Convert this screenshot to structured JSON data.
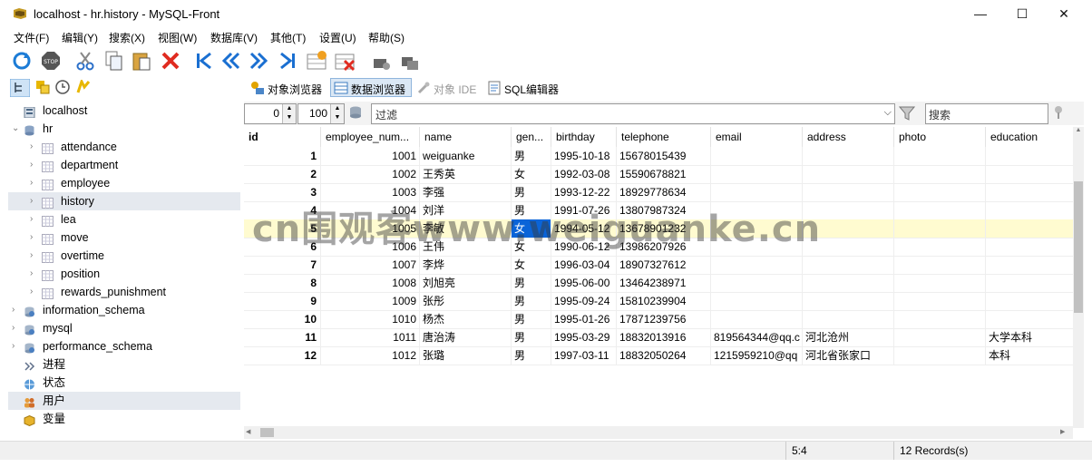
{
  "window": {
    "title": "localhost - hr.history - MySQL-Front",
    "minimize": "—",
    "maximize": "☐",
    "close": "✕"
  },
  "menu": [
    "文件(F)",
    "编辑(Y)",
    "搜索(X)",
    "视图(W)",
    "数据库(V)",
    "其他(T)",
    "设置(U)",
    "帮助(S)"
  ],
  "tabs": {
    "object_browser": "对象浏览器",
    "data_browser": "数据浏览器",
    "object_ide": "对象 IDE",
    "sql_editor": "SQL编辑器"
  },
  "tree": {
    "items": [
      {
        "label": "localhost",
        "level": 0,
        "icon": "server-icon",
        "chevron": ""
      },
      {
        "label": "hr",
        "level": 0,
        "icon": "database-icon",
        "chevron": "⌄"
      },
      {
        "label": "attendance",
        "level": 1,
        "icon": "table-icon",
        "chevron": "›"
      },
      {
        "label": "department",
        "level": 1,
        "icon": "table-icon",
        "chevron": "›"
      },
      {
        "label": "employee",
        "level": 1,
        "icon": "table-icon",
        "chevron": "›"
      },
      {
        "label": "history",
        "level": 1,
        "icon": "table-icon",
        "chevron": "›",
        "selected": true
      },
      {
        "label": "lea",
        "level": 1,
        "icon": "table-icon",
        "chevron": "›"
      },
      {
        "label": "move",
        "level": 1,
        "icon": "table-icon",
        "chevron": "›"
      },
      {
        "label": "overtime",
        "level": 1,
        "icon": "table-icon",
        "chevron": "›"
      },
      {
        "label": "position",
        "level": 1,
        "icon": "table-icon",
        "chevron": "›"
      },
      {
        "label": "rewards_punishment",
        "level": 1,
        "icon": "table-icon",
        "chevron": "›"
      },
      {
        "label": "information_schema",
        "level": 0,
        "icon": "system-db-icon",
        "chevron": "›"
      },
      {
        "label": "mysql",
        "level": 0,
        "icon": "system-db-icon",
        "chevron": "›"
      },
      {
        "label": "performance_schema",
        "level": 0,
        "icon": "system-db-icon",
        "chevron": "›"
      },
      {
        "label": "进程",
        "level": 0,
        "icon": "process-icon",
        "chevron": ""
      },
      {
        "label": "状态",
        "level": 0,
        "icon": "status-icon",
        "chevron": ""
      },
      {
        "label": "用户",
        "level": 0,
        "icon": "users-icon",
        "chevron": "",
        "highlight": true
      },
      {
        "label": "变量",
        "level": 0,
        "icon": "variables-icon",
        "chevron": ""
      }
    ]
  },
  "filter": {
    "offset": "0",
    "limit": "100",
    "filter_placeholder": "过滤",
    "search_placeholder": "搜索"
  },
  "grid": {
    "columns": [
      "id",
      "employee_num...",
      "name",
      "gen...",
      "birthday",
      "telephone",
      "email",
      "address",
      "photo",
      "education"
    ],
    "rows": [
      [
        "1",
        "1001",
        "weiguanke",
        "男",
        "1995-10-18",
        "15678015439",
        "",
        "",
        "",
        ""
      ],
      [
        "2",
        "1002",
        "王秀英",
        "女",
        "1992-03-08",
        "15590678821",
        "",
        "",
        "",
        ""
      ],
      [
        "3",
        "1003",
        "李强",
        "男",
        "1993-12-22",
        "18929778634",
        "",
        "",
        "",
        ""
      ],
      [
        "4",
        "1004",
        "刘洋",
        "男",
        "1991-07-26",
        "13807987324",
        "",
        "",
        "",
        ""
      ],
      [
        "5",
        "1005",
        "李敏",
        "女",
        "1994-05-12",
        "13678901232",
        "",
        "",
        "",
        ""
      ],
      [
        "6",
        "1006",
        "王伟",
        "女",
        "1990-06-12",
        "13986207926",
        "",
        "",
        "",
        ""
      ],
      [
        "7",
        "1007",
        "李烨",
        "女",
        "1996-03-04",
        "18907327612",
        "",
        "",
        "",
        ""
      ],
      [
        "8",
        "1008",
        "刘旭亮",
        "男",
        "1995-06-00",
        "13464238971",
        "",
        "",
        "",
        ""
      ],
      [
        "9",
        "1009",
        "张彤",
        "男",
        "1995-09-24",
        "15810239904",
        "",
        "",
        "",
        ""
      ],
      [
        "10",
        "1010",
        "杨杰",
        "男",
        "1995-01-26",
        "17871239756",
        "",
        "",
        "",
        ""
      ],
      [
        "11",
        "1011",
        "唐治涛",
        "男",
        "1995-03-29",
        "18832013916",
        "819564344@qq.c",
        "河北沧州",
        "",
        "大学本科"
      ],
      [
        "12",
        "1012",
        "张璐",
        "男",
        "1997-03-11",
        "18832050264",
        "1215959210@qq",
        "河北省张家口",
        "",
        "本科"
      ]
    ]
  },
  "status": {
    "position": "5:4",
    "records": "12 Records(s)"
  },
  "watermark": "cn围观客www.weiguanke.cn",
  "colors": {
    "selected_row": "#fffbd0",
    "selected_cell": "#0a64d8",
    "tree_selection": "#e5e9ef"
  }
}
